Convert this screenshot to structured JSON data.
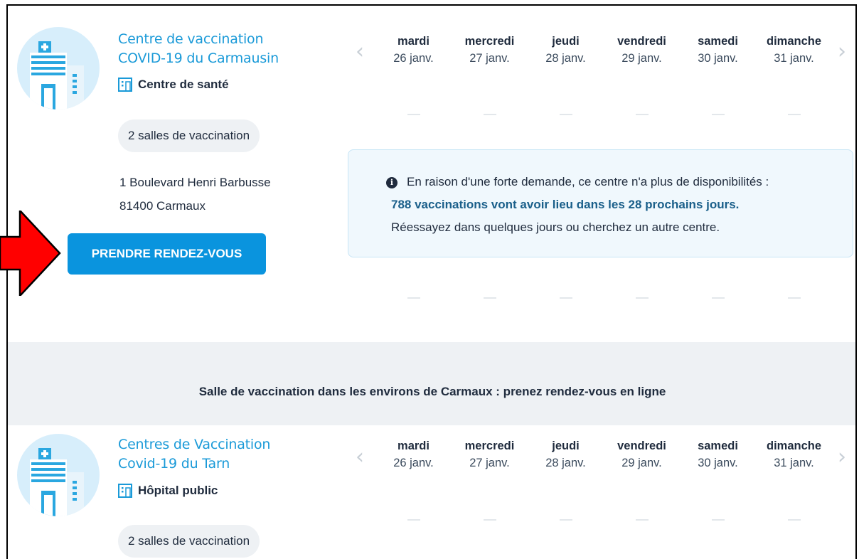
{
  "days": [
    {
      "name": "mardi",
      "date": "26 janv."
    },
    {
      "name": "mercredi",
      "date": "27 janv."
    },
    {
      "name": "jeudi",
      "date": "28 janv."
    },
    {
      "name": "vendredi",
      "date": "29 janv."
    },
    {
      "name": "samedi",
      "date": "30 janv."
    },
    {
      "name": "dimanche",
      "date": "31 janv."
    }
  ],
  "center1": {
    "title_line1": "Centre de vaccination",
    "title_line2": "COVID-19 du Carmausin",
    "type": "Centre de santé",
    "rooms": "2 salles de vaccination",
    "address_line1": "1 Boulevard Henri Barbusse",
    "address_line2": "81400 Carmaux",
    "book_button": "PRENDRE RENDEZ-VOUS",
    "info": {
      "line1": "En raison d'une forte demande, ce centre n'a plus de disponibilités :",
      "line2": "788 vaccinations vont avoir lieu dans les 28 prochains jours.",
      "line3": "Réessayez dans quelques jours ou cherchez un autre centre."
    }
  },
  "section_heading": "Salle de vaccination dans les environs de Carmaux : prenez rendez-vous en ligne",
  "center2": {
    "title_line1": "Centres de Vaccination",
    "title_line2": "Covid-19 du Tarn",
    "type": "Hôpital public",
    "rooms": "2 salles de vaccination"
  },
  "colors": {
    "accent": "#0a94de",
    "title": "#1a9ad8",
    "annotation_arrow": "#ff0000"
  },
  "icons": {
    "prev": "chevron-left-icon",
    "next": "chevron-right-icon",
    "info": "info-icon",
    "building": "building-icon"
  }
}
